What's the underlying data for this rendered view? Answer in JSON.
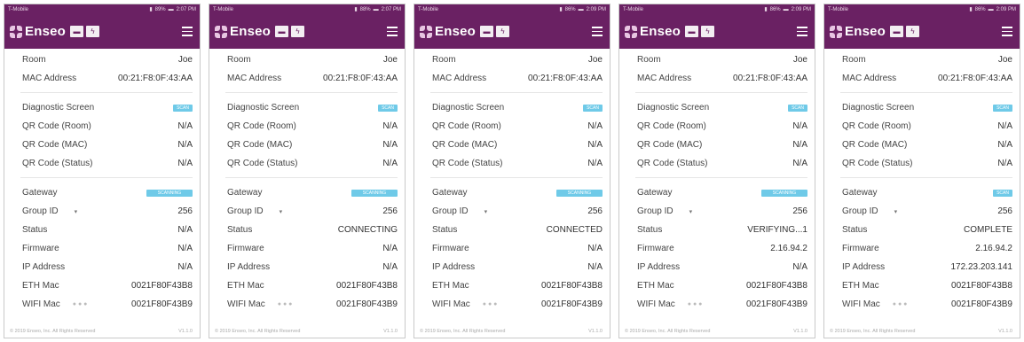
{
  "brand": "Enseo",
  "labels": {
    "room": "Room",
    "mac": "MAC Address",
    "diag": "Diagnostic Screen",
    "qr_room": "QR Code (Room)",
    "qr_mac": "QR Code (MAC)",
    "qr_status": "QR Code (Status)",
    "gateway": "Gateway",
    "group": "Group ID",
    "status": "Status",
    "firmware": "Firmware",
    "ip": "IP Address",
    "eth": "ETH Mac",
    "wifi": "WIFI Mac"
  },
  "phones": [
    {
      "carrier": "T-Mobile",
      "battery": "89%",
      "time": "2:07 PM",
      "room": "Joe",
      "mac": "00:21:F8:0F:43:AA",
      "diag_btn": "SCAN",
      "qr_room": "N/A",
      "qr_mac": "N/A",
      "qr_status": "N/A",
      "gateway_btn": "SCANNING",
      "group": "256",
      "status": "N/A",
      "firmware": "N/A",
      "ip": "N/A",
      "eth": "0021F80F43B8",
      "wifi": "0021F80F43B9",
      "footer": "© 2019 Enseo, Inc. All Rights Reserved",
      "version": "V1.1.0"
    },
    {
      "carrier": "T-Mobile",
      "battery": "88%",
      "time": "2:07 PM",
      "room": "Joe",
      "mac": "00:21:F8:0F:43:AA",
      "diag_btn": "SCAN",
      "qr_room": "N/A",
      "qr_mac": "N/A",
      "qr_status": "N/A",
      "gateway_btn": "SCANNING",
      "group": "256",
      "status": "CONNECTING",
      "firmware": "N/A",
      "ip": "N/A",
      "eth": "0021F80F43B8",
      "wifi": "0021F80F43B9",
      "footer": "© 2019 Enseo, Inc. All Rights Reserved",
      "version": "V1.1.0"
    },
    {
      "carrier": "T-Mobile",
      "battery": "86%",
      "time": "2:09 PM",
      "room": "Joe",
      "mac": "00:21:F8:0F:43:AA",
      "diag_btn": "SCAN",
      "qr_room": "N/A",
      "qr_mac": "N/A",
      "qr_status": "N/A",
      "gateway_btn": "SCANNING",
      "group": "256",
      "status": "CONNECTED",
      "firmware": "N/A",
      "ip": "N/A",
      "eth": "0021F80F43B8",
      "wifi": "0021F80F43B9",
      "footer": "© 2019 Enseo, Inc. All Rights Reserved",
      "version": "V1.1.0"
    },
    {
      "carrier": "T-Mobile",
      "battery": "86%",
      "time": "2:09 PM",
      "room": "Joe",
      "mac": "00:21:F8:0F:43:AA",
      "diag_btn": "SCAN",
      "qr_room": "N/A",
      "qr_mac": "N/A",
      "qr_status": "N/A",
      "gateway_btn": "SCANNING",
      "group": "256",
      "status": "VERIFYING...1",
      "firmware": "2.16.94.2",
      "ip": "N/A",
      "eth": "0021F80F43B8",
      "wifi": "0021F80F43B9",
      "footer": "© 2019 Enseo, Inc. All Rights Reserved",
      "version": "V1.1.0"
    },
    {
      "carrier": "T-Mobile",
      "battery": "86%",
      "time": "2:09 PM",
      "room": "Joe",
      "mac": "00:21:F8:0F:43:AA",
      "diag_btn": "SCAN",
      "qr_room": "N/A",
      "qr_mac": "N/A",
      "qr_status": "N/A",
      "gateway_btn": "SCAN",
      "group": "256",
      "status": "COMPLETE",
      "firmware": "2.16.94.2",
      "ip": "172.23.203.141",
      "eth": "0021F80F43B8",
      "wifi": "0021F80F43B9",
      "footer": "© 2019 Enseo, Inc. All Rights Reserved",
      "version": "V1.1.0"
    }
  ]
}
